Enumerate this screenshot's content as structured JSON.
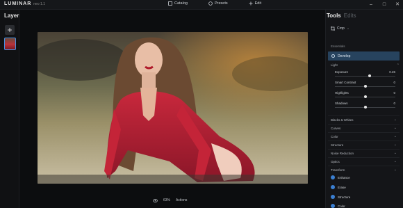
{
  "app": {
    "brand": "LUMINAR",
    "version": "neo 1.1"
  },
  "top_nav": [
    {
      "label": "Catalog",
      "icon": "catalog-icon"
    },
    {
      "label": "Presets",
      "icon": "presets-icon"
    },
    {
      "label": "Edit",
      "icon": "edit-icon"
    }
  ],
  "window_controls": [
    "minimize",
    "maximize",
    "close"
  ],
  "layers": {
    "title": "Layers",
    "add_label": "+"
  },
  "tools_panel": {
    "tab_active": "Tools",
    "tab_inactive": "Edits",
    "crop_label": "Crop",
    "section_label": "Essentials",
    "develop_label": "Develop",
    "light_label": "Light",
    "sliders": [
      {
        "label": "Exposure",
        "value": "0.26",
        "fraction": 0.58
      },
      {
        "label": "Smart Contrast",
        "value": "0",
        "fraction": 0.5
      },
      {
        "label": "Highlights",
        "value": "0",
        "fraction": 0.5
      },
      {
        "label": "Shadows",
        "value": "0",
        "fraction": 0.5
      }
    ],
    "groups": [
      "Blacks & Whites",
      "Curves",
      "Color",
      "Structure",
      "Noise Reduction",
      "Optics",
      "Transform"
    ],
    "sub_tools": [
      "Enhance",
      "Erase",
      "Structure",
      "Color"
    ]
  },
  "bottom_bar": {
    "zoom": "63%",
    "actions": "Actions"
  },
  "colors": {
    "accent": "#3b7fd1",
    "develop_bg": "#27435e",
    "dress": "#b8283a"
  }
}
